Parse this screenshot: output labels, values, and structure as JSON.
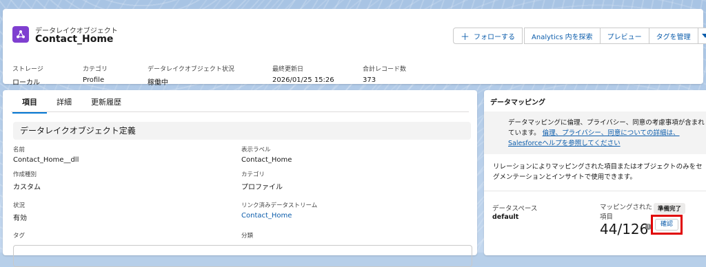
{
  "header": {
    "object_type": "データレイクオブジェクト",
    "title": "Contact_Home",
    "buttons": {
      "follow": "フォローする",
      "analytics": "Analytics 内を探索",
      "preview": "プレビュー",
      "manage_tags": "タグを管理"
    },
    "meta": [
      {
        "label": "ストレージ",
        "value": "ローカル"
      },
      {
        "label": "カテゴリ",
        "value": "Profile"
      },
      {
        "label": "データレイクオブジェクト状況",
        "value": "稼働中"
      },
      {
        "label": "最終更新日",
        "value": "2026/01/25 15:26"
      },
      {
        "label": "合計レコード数",
        "value": "373"
      }
    ]
  },
  "tabs": [
    "項目",
    "詳細",
    "更新履歴"
  ],
  "section": {
    "title": "データレイクオブジェクト定義",
    "fields": [
      {
        "label": "名前",
        "value": "Contact_Home__dll"
      },
      {
        "label": "表示ラベル",
        "value": "Contact_Home"
      },
      {
        "label": "作成種別",
        "value": "カスタム"
      },
      {
        "label": "カテゴリ",
        "value": "プロファイル"
      },
      {
        "label": "状況",
        "value": "有効"
      },
      {
        "label": "リンク済みデータストリーム",
        "value": "Contact_Home"
      },
      {
        "label": "タグ",
        "value": ""
      },
      {
        "label": "分類",
        "value": ""
      }
    ]
  },
  "side": {
    "title": "データマッピング",
    "info_text": "データマッピングに倫理、プライバシー、同意の考慮事項が含まれています。",
    "info_link": "倫理、プライバシー、同意についての詳細は、Salesforceヘルプを参照してください",
    "description": "リレーションによりマッピングされた項目またはオブジェクトのみをセグメンテーションとインサイトで使用できます。",
    "dataspace_label": "データスペース",
    "dataspace_value": "default",
    "mapped_label": "マッピングされた項目",
    "status_badge": "準備完了",
    "mapped_count": "44/126",
    "confirm_button": "確認"
  },
  "colors": {
    "accent": "#0176d3",
    "icon_bg": "#7f3fd0",
    "highlight": "#e00000"
  }
}
